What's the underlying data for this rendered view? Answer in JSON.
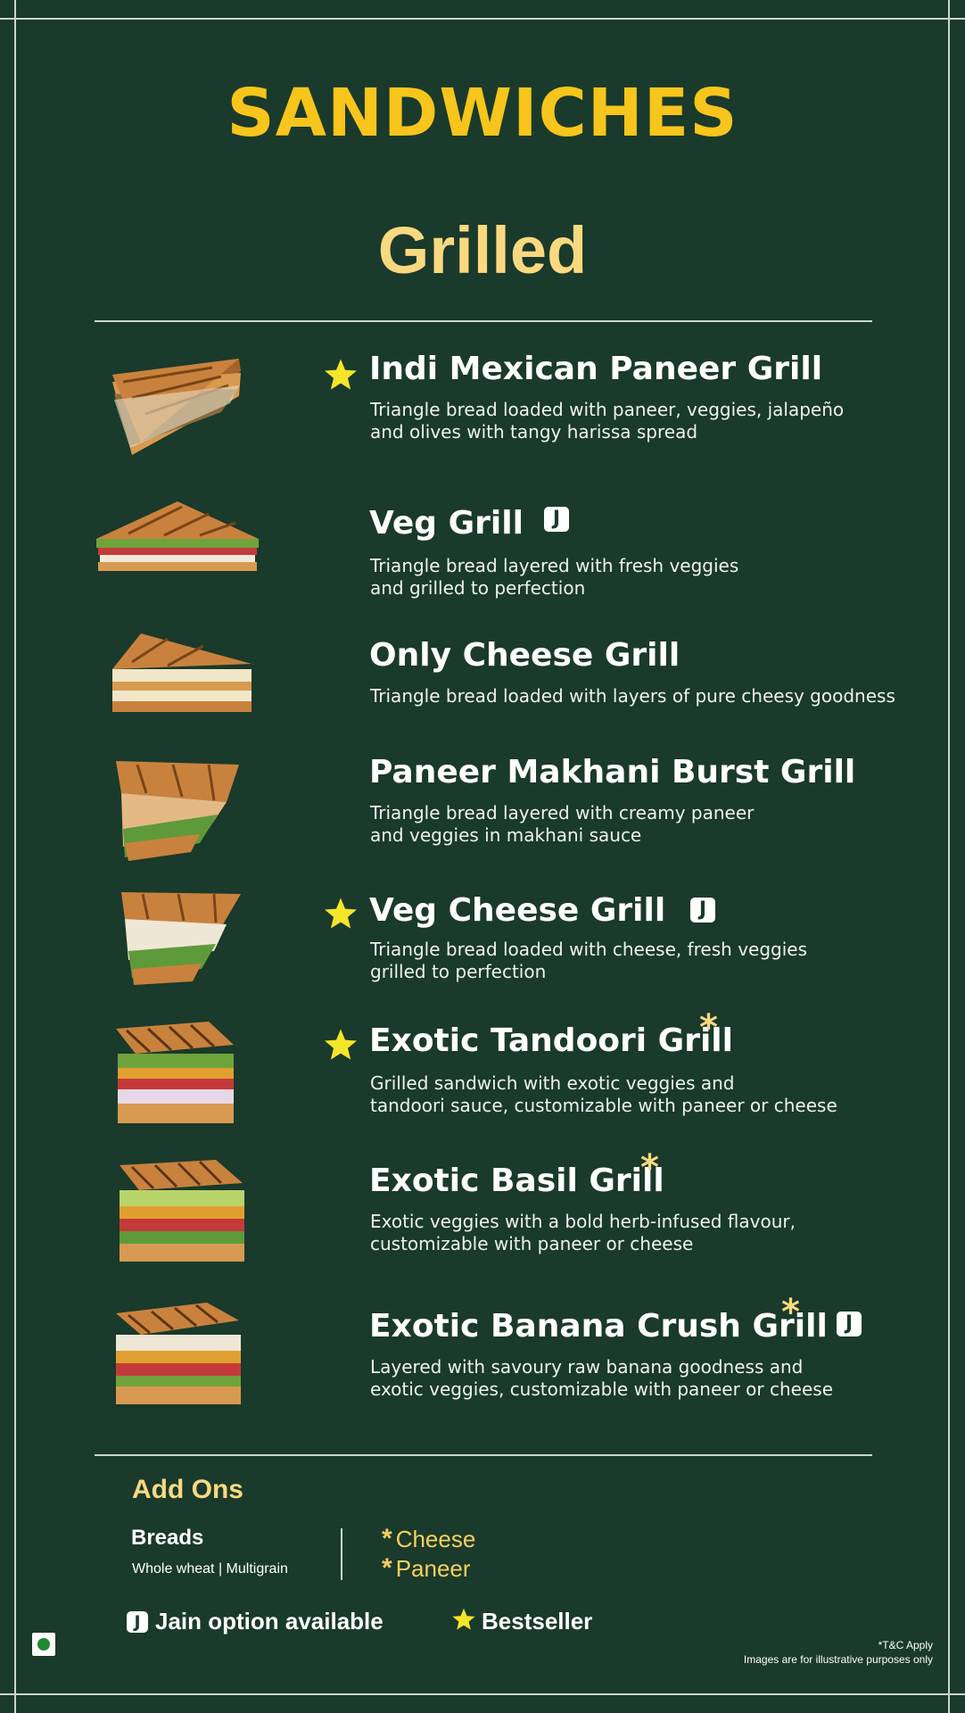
{
  "header": {
    "title": "SANDWICHES",
    "section": "Grilled"
  },
  "items": [
    {
      "name": "Indi Mexican Paneer Grill",
      "desc": "Triangle bread loaded with paneer, veggies, jalapeño\nand olives with tangy harissa spread",
      "bestseller": true,
      "jain": false,
      "customizable": false
    },
    {
      "name": "Veg Grill",
      "desc": "Triangle bread layered with fresh veggies\nand grilled to perfection",
      "bestseller": false,
      "jain": true,
      "customizable": false
    },
    {
      "name": "Only Cheese Grill",
      "desc": "Triangle bread loaded with layers of pure cheesy goodness",
      "bestseller": false,
      "jain": false,
      "customizable": false
    },
    {
      "name": "Paneer Makhani Burst Grill",
      "desc": "Triangle bread layered with creamy paneer\nand veggies in makhani sauce",
      "bestseller": false,
      "jain": false,
      "customizable": false
    },
    {
      "name": "Veg Cheese Grill",
      "desc": "Triangle bread loaded with cheese, fresh veggies\ngrilled to perfection",
      "bestseller": true,
      "jain": true,
      "customizable": false
    },
    {
      "name": "Exotic Tandoori Grill",
      "desc": "Grilled sandwich with exotic veggies and\ntandoori sauce, customizable with paneer or cheese",
      "bestseller": true,
      "jain": false,
      "customizable": true
    },
    {
      "name": "Exotic Basil Grill",
      "desc": "Exotic veggies with a bold herb-infused flavour,\ncustomizable with paneer or cheese",
      "bestseller": false,
      "jain": false,
      "customizable": true
    },
    {
      "name": "Exotic Banana Crush Grill",
      "desc": "Layered with savoury raw banana goodness and\nexotic veggies, customizable with paneer or cheese",
      "bestseller": false,
      "jain": true,
      "customizable": true
    }
  ],
  "addons": {
    "title": "Add Ons",
    "breads_label": "Breads",
    "breads_options": "Whole wheat | Multigrain",
    "extras": [
      "Cheese",
      "Paneer"
    ],
    "extra_marker": "*"
  },
  "legend": {
    "jain_badge": "J",
    "jain_label": "Jain option available",
    "bestseller_label": "Bestseller"
  },
  "footer": {
    "tc": "*T&C Apply",
    "disclaimer": "Images are for illustrative purposes only"
  },
  "colors": {
    "background": "#1a3a2b",
    "title_yellow": "#f7c51b",
    "section_yellow": "#f9d980",
    "star_yellow": "#f5e52a",
    "veg_green": "#1f8a2f"
  },
  "icons": {
    "bestseller": "star-icon",
    "jain": "jain-badge-icon",
    "veg": "veg-mark-icon"
  }
}
